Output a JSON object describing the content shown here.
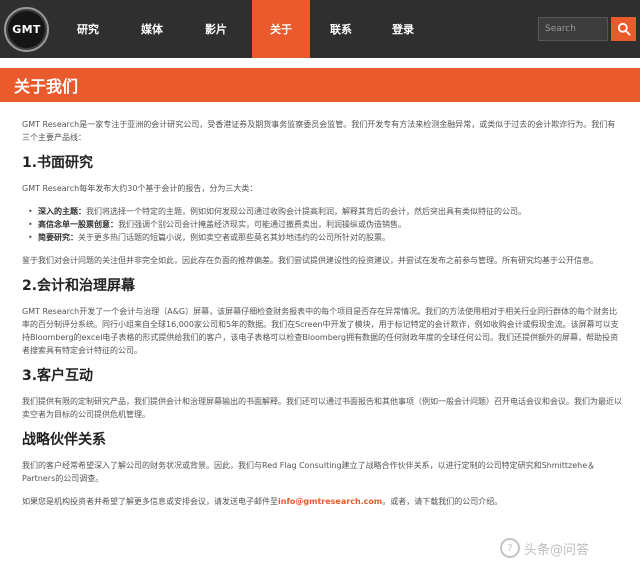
{
  "brand": {
    "logo_text": "GMT"
  },
  "nav": {
    "items": [
      {
        "label": "研究"
      },
      {
        "label": "媒体"
      },
      {
        "label": "影片"
      },
      {
        "label": "关于"
      },
      {
        "label": "联系"
      },
      {
        "label": "登录"
      }
    ],
    "active_index": 3
  },
  "search": {
    "placeholder": "Search",
    "icon": "search-icon"
  },
  "colors": {
    "accent": "#e95a2c",
    "topbar": "#2f2f2f",
    "text": "#555555"
  },
  "page": {
    "title": "关于我们",
    "intro": "GMT Research是一家专注于亚洲的会计研究公司，受香港证券及期货事务监察委员会监管。我们开发专有方法来检测金融异常，或类似于过去的会计欺诈行为。我们有三个主要产品线：",
    "sections": [
      {
        "heading": "1.书面研究",
        "para1": "GMT Research每年发布大约30个基于会计的报告，分为三大类：",
        "bullets": [
          {
            "term": "深入的主题：",
            "text": "我们将选择一个特定的主题，例如如何发现公司通过收购会计提高利润，解释其背后的会计，然后突出具有类似特征的公司。"
          },
          {
            "term": "高信念单一股票创意：",
            "text": "我们强调个别公司会计掩盖经济现实，可能通过撤费卖出，利润操纵或伪造销售。"
          },
          {
            "term": "简要研究：",
            "text": "关于更多热门话题的短篇小说，例如卖空者或那些莫名其妙地违约的公司所针对的股票。"
          }
        ],
        "para2": "鉴于我们对会计问题的关注但并非完全如此，因此存在负面的推荐偏差。我们尝试提供建设性的投资建议，并尝试在发布之前参与管理。所有研究均基于公开信息。"
      },
      {
        "heading": "2.会计和治理屏幕",
        "para1": "GMT Research开发了一个会计与治理（A&G）屏幕，该屏幕仔细检查财务报表中的每个项目是否存在异常情况。我们的方法使用相对于相关行业同行群体的每个财务比率的百分制评分系统。同行小组来自全球16,000家公司和5年的数据。我们在Screen中开发了模块，用于标记特定的会计欺诈，例如收购会计或假现金流。该屏幕可以支持Bloomberg的excel电子表格的形式提供给我们的客户，该电子表格可以检查Bloomberg拥有数据的任何财政年度的全球任何公司。我们还提供额外的屏幕，帮助投资者搜索具有特定会计特征的公司。"
      },
      {
        "heading": "3.客户互动",
        "para1": "我们提供有限的定制研究产品，我们提供会计和治理屏幕输出的书面解释。我们还可以通过书面报告和其他事项（例如一般会计问题）召开电话会议和会议。我们为最近以卖空者为目标的公司提供危机管理。"
      },
      {
        "heading": "战略伙伴关系",
        "para1": "我们的客户经常希望深入了解公司的财务状况或背景。因此，我们与Red Flag Consulting建立了战略合作伙伴关系，以进行定制的公司特定研究和Shmittzehe＆Partners的公司调查。"
      }
    ],
    "footer_text_before": "如果您是机构投资者并希望了解更多信息或安排会议，请发送电子邮件至",
    "footer_email": "info@gmtresearch.com",
    "footer_text_after": "。或者，请下载我们的公司介绍。"
  },
  "watermark": {
    "text": "头条@问答"
  }
}
